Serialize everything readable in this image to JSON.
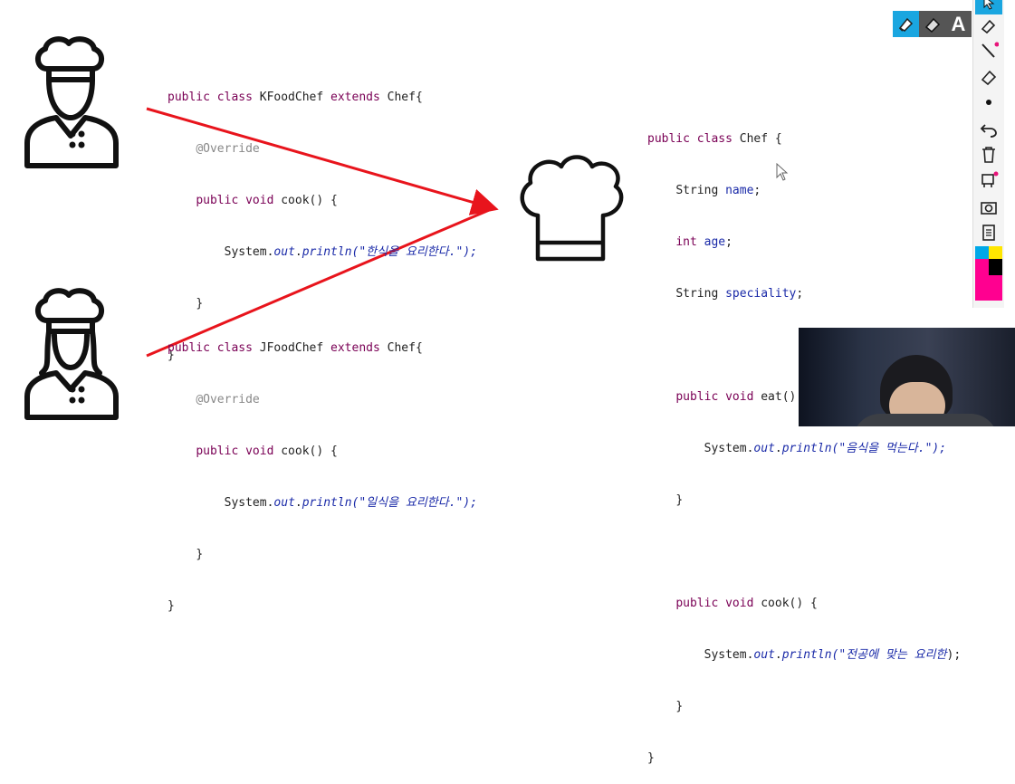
{
  "slide": {
    "kfood_code": {
      "line1": {
        "kw": "public class ",
        "name": "KFoodChef ",
        "kw2": "extends ",
        "rest": "Chef{"
      },
      "line2": "@Override",
      "line3": {
        "kw": "public void ",
        "rest": "cook() {"
      },
      "line4": {
        "pre": "System.",
        "out": "out",
        "dot": ".",
        "println": "println",
        "str": "(\"한식을 요리한다.\");"
      },
      "line5": "}",
      "line6": "}"
    },
    "jfood_code": {
      "line1": {
        "kw": "public class ",
        "name": "JFoodChef ",
        "kw2": "extends ",
        "rest": "Chef{"
      },
      "line2": "@Override",
      "line3": {
        "kw": "public void ",
        "rest": "cook() {"
      },
      "line4": {
        "pre": "System.",
        "out": "out",
        "dot": ".",
        "println": "println",
        "str": "(\"일식을 요리한다.\");"
      },
      "line5": "}",
      "line6": "}"
    },
    "chef_code": {
      "line1": {
        "kw": "public class ",
        "rest": "Chef {"
      },
      "line2": {
        "type": "String ",
        "field": "name",
        "end": ";"
      },
      "line3": {
        "type": "int ",
        "field": "age",
        "end": ";"
      },
      "line4": {
        "type": "String ",
        "field": "speciality",
        "end": ";"
      },
      "line5": {
        "kw": "public void ",
        "rest": "eat() {"
      },
      "line6": {
        "pre": "System.",
        "out": "out",
        "dot": ".",
        "println": "println",
        "str": "(\"음식을 먹는다.\");"
      },
      "line7": "}",
      "line8": {
        "kw": "public void ",
        "rest": "cook() {"
      },
      "line9": {
        "pre": "System.",
        "out": "out",
        "dot": ".",
        "println": "println",
        "str": "(\"전공에 맞는 요리한",
        "end": ");"
      },
      "line10": "}",
      "line11": "}"
    }
  },
  "toolbar": {
    "top_tools": [
      "highlighter-icon",
      "eraser-icon",
      "text-icon"
    ],
    "text_tool_label": "A",
    "side_tools": [
      "cursor-icon",
      "highlighter-icon",
      "pen-icon",
      "eraser-icon",
      "dot-icon",
      "undo-icon",
      "trash-icon",
      "stamp-icon",
      "camera-icon",
      "notes-icon"
    ],
    "palette": [
      "#00a8e8",
      "#ffe600",
      "#ff0090",
      "#000000"
    ]
  },
  "colors": {
    "arrow": "#e8141c",
    "accent": "#1aa6e0"
  }
}
